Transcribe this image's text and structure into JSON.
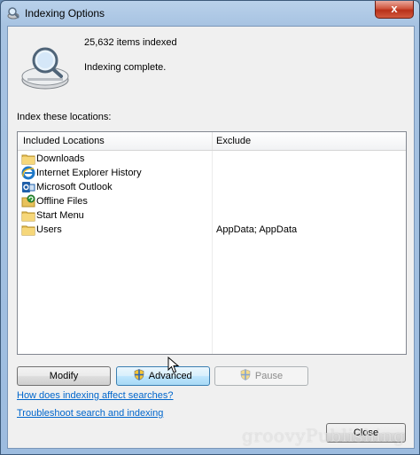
{
  "window": {
    "title": "Indexing Options",
    "close_glyph": "x"
  },
  "status": {
    "items_count": "25,632 items indexed",
    "message": "Indexing complete."
  },
  "locations": {
    "section_label": "Index these locations:",
    "columns": {
      "included": "Included Locations",
      "exclude": "Exclude"
    },
    "rows": [
      {
        "name": "Downloads",
        "exclude": "",
        "icon": "folder-icon"
      },
      {
        "name": "Internet Explorer History",
        "exclude": "",
        "icon": "internet-explorer-icon"
      },
      {
        "name": "Microsoft Outlook",
        "exclude": "",
        "icon": "outlook-icon"
      },
      {
        "name": "Offline Files",
        "exclude": "",
        "icon": "offline-files-icon"
      },
      {
        "name": "Start Menu",
        "exclude": "",
        "icon": "folder-icon"
      },
      {
        "name": "Users",
        "exclude": "AppData; AppData",
        "icon": "folder-icon"
      }
    ]
  },
  "buttons": {
    "modify": "Modify",
    "advanced": "Advanced",
    "pause": "Pause",
    "close": "Close"
  },
  "links": {
    "help": "How does indexing affect searches?",
    "troubleshoot": "Troubleshoot search and indexing"
  },
  "watermark": "groovyPublishing",
  "colors": {
    "link": "#0066cc",
    "title_bar": "#a7c3e2",
    "close_button": "#c8402a"
  }
}
